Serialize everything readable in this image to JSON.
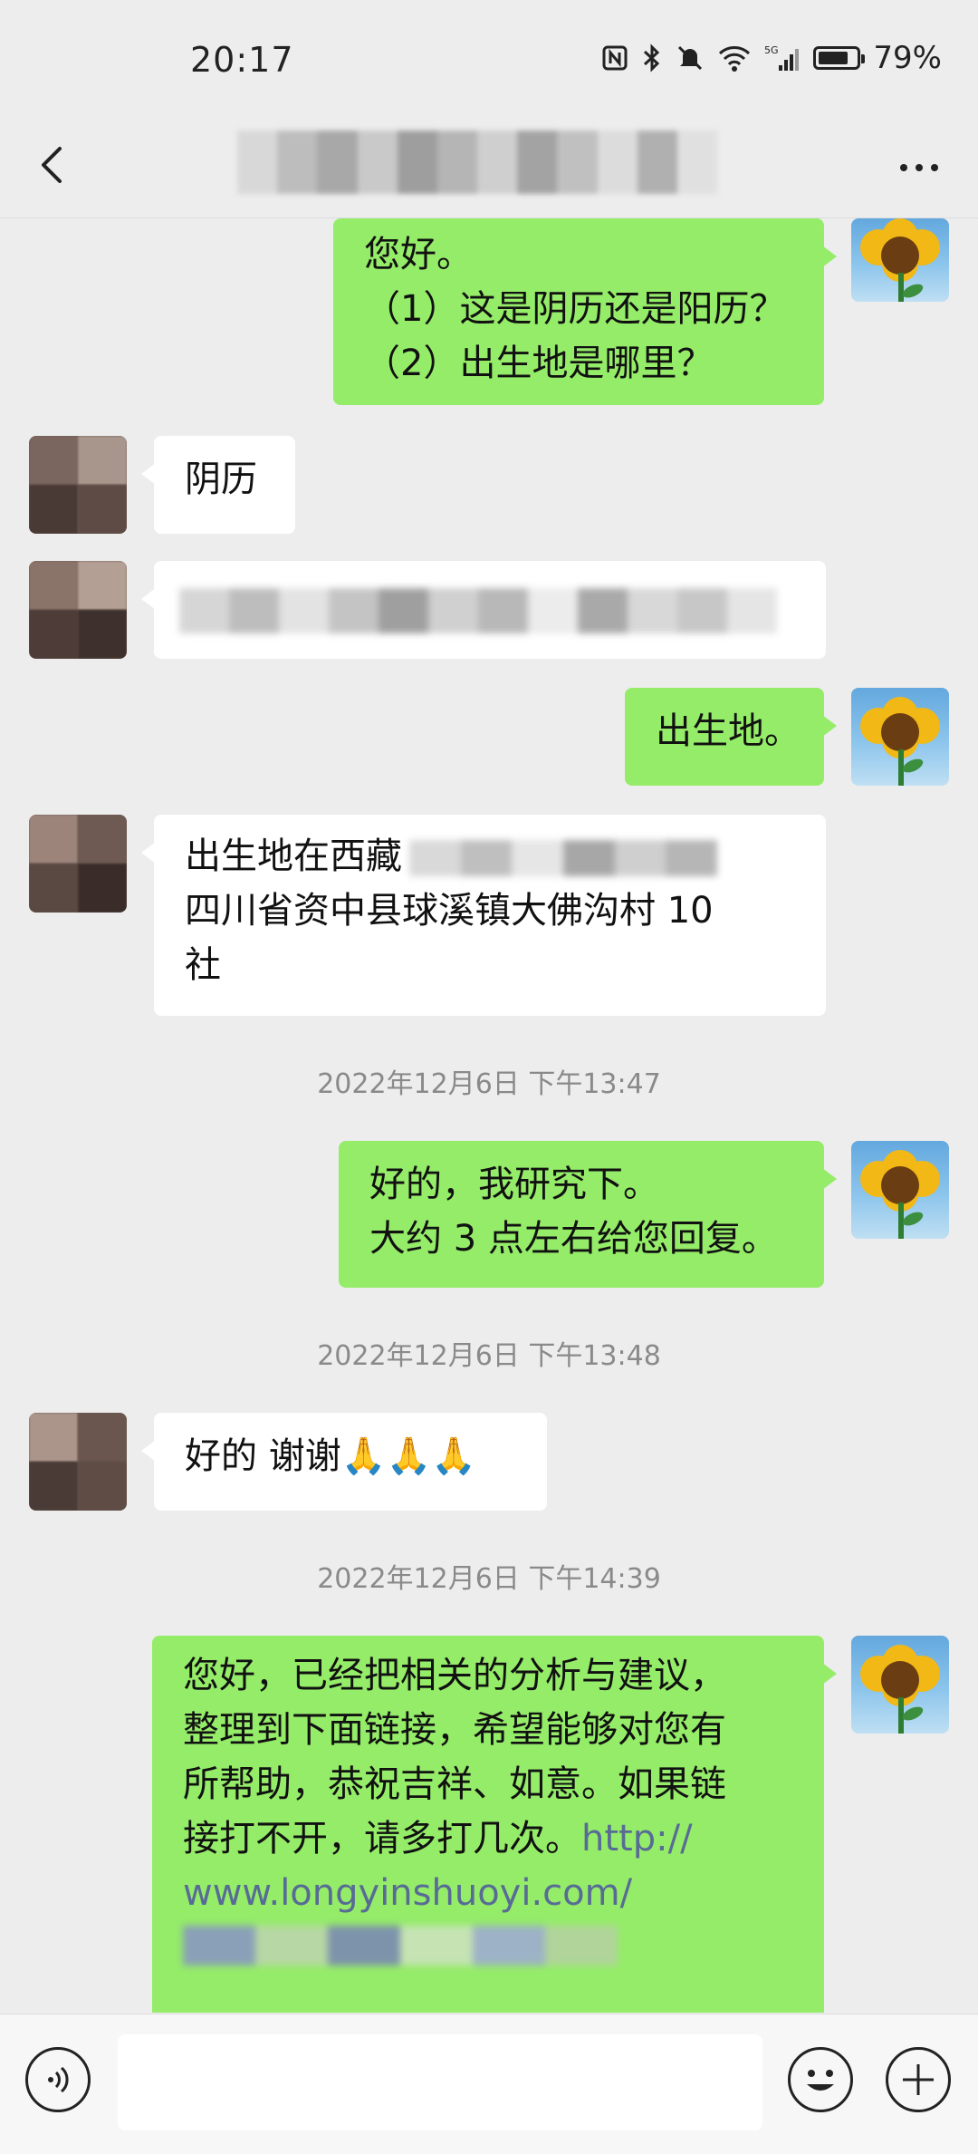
{
  "status_bar": {
    "time": "20:17",
    "battery_percent": "79%",
    "battery_level": 0.79,
    "icons": [
      "nfc-icon",
      "bluetooth-icon",
      "mute-icon",
      "wifi-icon",
      "5g-signal-icon",
      "battery-icon"
    ]
  },
  "nav": {
    "back_icon": "chevron-left-icon",
    "more_icon": "more-dots-icon"
  },
  "messages": [
    {
      "side": "me",
      "lines": [
        "您好。",
        "（1）这是阴历还是阳历？",
        "（2）出生地是哪里？"
      ]
    },
    {
      "side": "other",
      "lines": [
        "阴历"
      ]
    },
    {
      "side": "other",
      "lines": [],
      "blurred_tail": "…"
    },
    {
      "side": "me",
      "lines": [
        "出生地。"
      ]
    },
    {
      "side": "other",
      "lines": [
        " 出生地在西藏",
        "四川省资中县球溪镇大佛沟村 10",
        "社"
      ]
    },
    {
      "side": "me",
      "lines": [
        "好的，我研究下。",
        "大约 3 点左右给您回复。"
      ]
    },
    {
      "side": "other",
      "lines": [
        "好的  谢谢🙏🙏🙏"
      ]
    },
    {
      "side": "me",
      "lines": [
        "您好，已经把相关的分析与建议，",
        "整理到下面链接，希望能够对您有",
        "所帮助，恭祝吉祥、如意。如果链",
        "接打不开，请多打几次。"
      ],
      "link_lines": [
        "http://",
        "www.longyinshuoyi.com/"
      ]
    }
  ],
  "timestamps": [
    "2022年12月6日 下午13:47",
    "2022年12月6日 下午13:48",
    "2022年12月6日 下午14:39"
  ],
  "input_bar": {
    "voice_icon": "voice-icon",
    "emoji_icon": "emoji-icon",
    "plus_icon": "plus-icon",
    "placeholder": ""
  },
  "colors": {
    "background": "#ededed",
    "my_bubble": "#95ec69",
    "other_bubble": "#ffffff",
    "link": "#576b95",
    "timestamp": "#8a8a8a"
  }
}
